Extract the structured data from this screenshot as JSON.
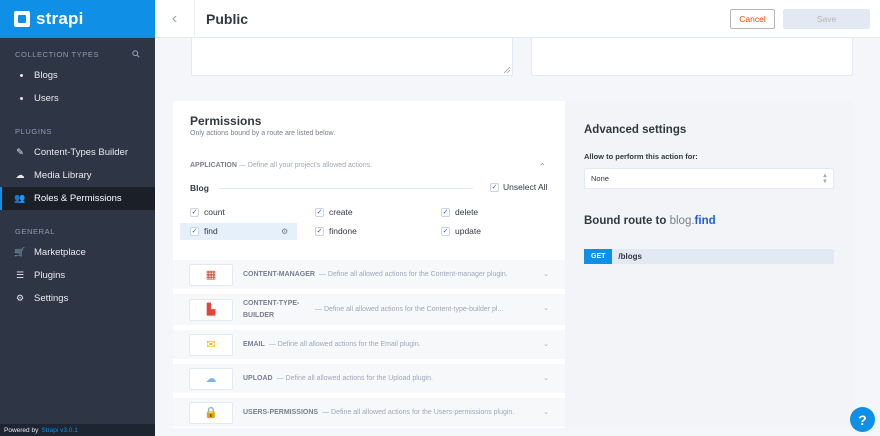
{
  "brand": {
    "name": "strapi",
    "accent": "#0f8fe6"
  },
  "sidebar": {
    "collection_title": "COLLECTION TYPES",
    "collection_items": [
      {
        "label": "Blogs"
      },
      {
        "label": "Users"
      }
    ],
    "plugins_title": "PLUGINS",
    "plugin_items": [
      {
        "label": "Content-Types Builder",
        "icon": "pencil-icon"
      },
      {
        "label": "Media Library",
        "icon": "cloud-icon"
      },
      {
        "label": "Roles & Permissions",
        "icon": "users-icon",
        "active": true
      }
    ],
    "general_title": "GENERAL",
    "general_items": [
      {
        "label": "Marketplace",
        "icon": "shop-icon"
      },
      {
        "label": "Plugins",
        "icon": "list-icon"
      },
      {
        "label": "Settings",
        "icon": "gear-icon"
      }
    ],
    "powered": {
      "prefix": "Powered by",
      "link": "Strapi v3.0.1"
    }
  },
  "header": {
    "title": "Public",
    "cancel_label": "Cancel",
    "save_label": "Save"
  },
  "permissions": {
    "title": "Permissions",
    "subtitle": "Only actions bound by a route are listed below.",
    "application": {
      "name": "APPLICATION",
      "desc": "— Define all your project's allowed actions."
    },
    "group": {
      "label": "Blog",
      "unselect_label": "Unselect All"
    },
    "actions": [
      {
        "label": "count",
        "checked": true
      },
      {
        "label": "create",
        "checked": true
      },
      {
        "label": "delete",
        "checked": true
      },
      {
        "label": "find",
        "checked": true,
        "selected": true
      },
      {
        "label": "findone",
        "checked": true
      },
      {
        "label": "update",
        "checked": true
      }
    ],
    "plugins": [
      {
        "name": "CONTENT-MANAGER",
        "desc": "— Define all allowed actions for the Content-manager plugin.",
        "icon": "content-manager-icon"
      },
      {
        "name": "CONTENT-TYPE-BUILDER",
        "desc": "— Define all allowed actions for the Content-type-builder pl...",
        "icon": "content-type-builder-icon"
      },
      {
        "name": "EMAIL",
        "desc": "— Define all allowed actions for the Email plugin.",
        "icon": "email-icon"
      },
      {
        "name": "UPLOAD",
        "desc": "— Define all allowed actions for the Upload plugin.",
        "icon": "upload-icon"
      },
      {
        "name": "USERS-PERMISSIONS",
        "desc": "— Define all allowed actions for the Users-permissions plugin.",
        "icon": "lock-icon"
      }
    ]
  },
  "advanced": {
    "title": "Advanced settings",
    "policy_label": "Allow to perform this action for:",
    "policy_value": "None",
    "bound_prefix": "Bound route to",
    "bound_controller": "blog.",
    "bound_action": "find",
    "method": "GET",
    "path": "/blogs"
  },
  "help": {
    "label": "?"
  }
}
